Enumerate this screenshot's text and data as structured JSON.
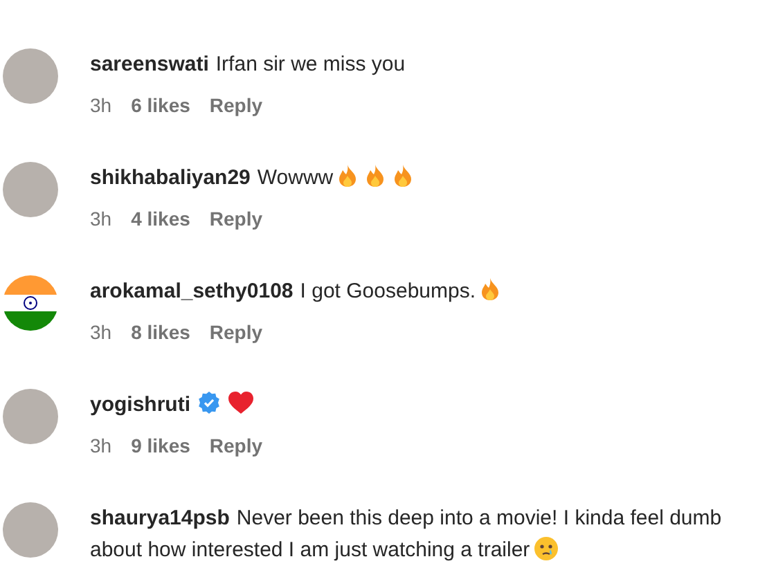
{
  "comments": [
    {
      "username": "sareenswati",
      "verified": false,
      "avatar": {
        "kind": "photo"
      },
      "text": "Irfan sir we miss you",
      "time": "3h",
      "likes": "6 likes",
      "reply": "Reply"
    },
    {
      "username": "shikhabaliyan29",
      "verified": false,
      "avatar": {
        "kind": "photo"
      },
      "text": "Wowww",
      "emojis": [
        {
          "kind": "fire"
        },
        {
          "kind": "fire"
        },
        {
          "kind": "fire"
        }
      ],
      "time": "3h",
      "likes": "4 likes",
      "reply": "Reply"
    },
    {
      "username": "arokamal_sethy0108",
      "verified": false,
      "avatar": {
        "kind": "flag"
      },
      "text": "I got Goosebumps.",
      "emojis": [
        {
          "kind": "fire"
        }
      ],
      "time": "3h",
      "likes": "8 likes",
      "reply": "Reply"
    },
    {
      "username": "yogishruti",
      "verified": true,
      "avatar": {
        "kind": "photo"
      },
      "emojis": [
        {
          "kind": "heart"
        }
      ],
      "time": "3h",
      "likes": "9 likes",
      "reply": "Reply"
    },
    {
      "username": "shaurya14psb",
      "verified": false,
      "avatar": {
        "kind": "photo"
      },
      "text": "Never been this deep into a movie! I kinda feel dumb about how interested I am just watching a trailer",
      "emojis": [
        {
          "kind": "tear"
        }
      ]
    }
  ]
}
